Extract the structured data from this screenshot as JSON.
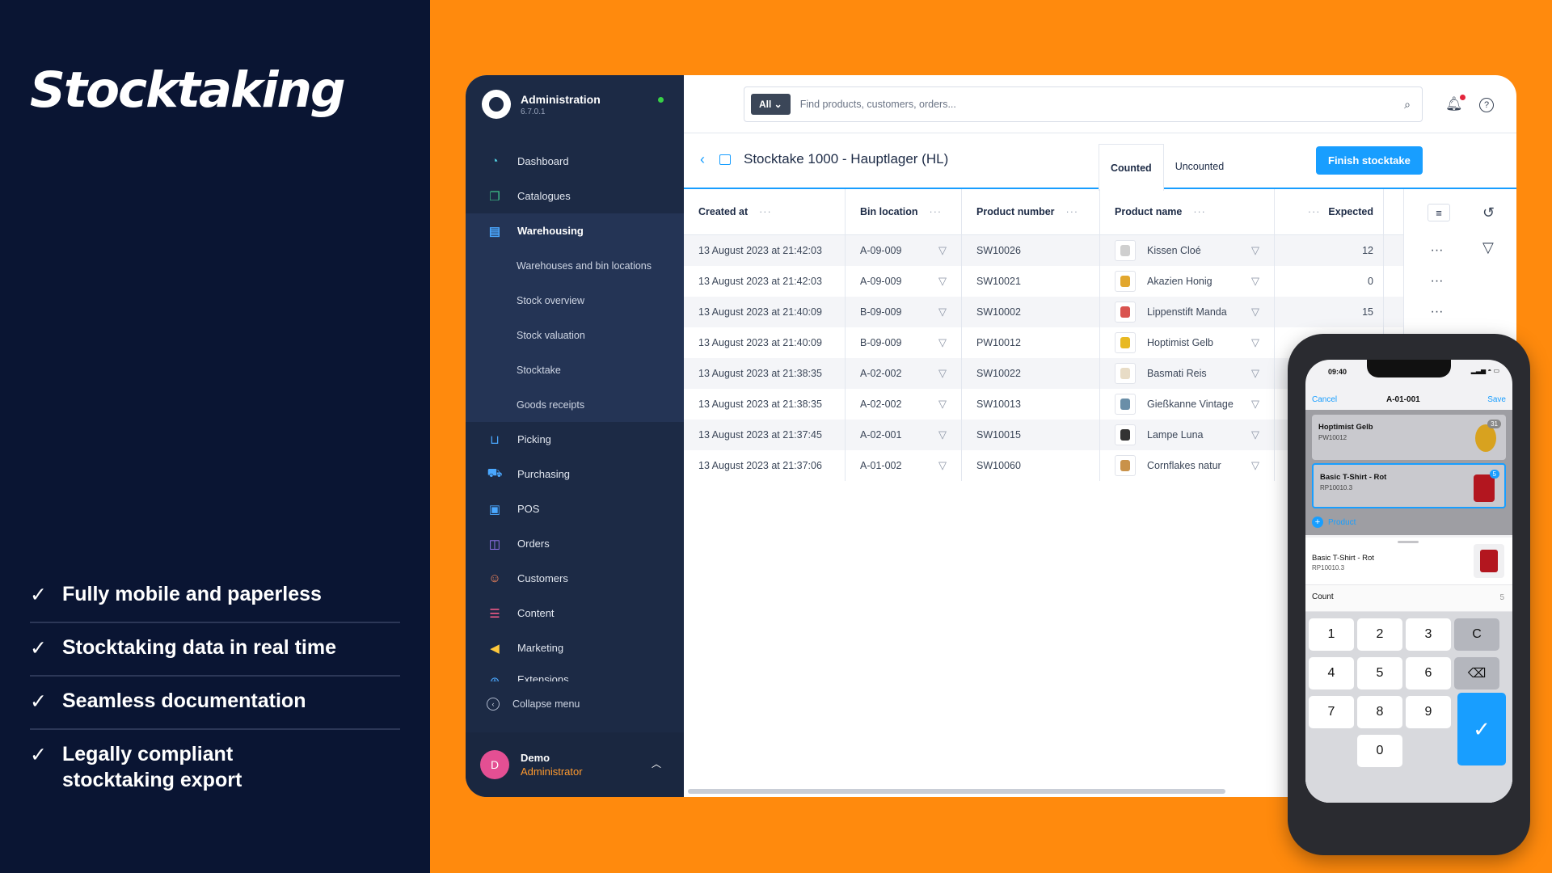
{
  "marketing": {
    "headline": "Stocktaking",
    "features": [
      {
        "label": "Fully mobile and paperless"
      },
      {
        "label": "Stocktaking data in real time"
      },
      {
        "label": "Seamless documentation"
      },
      {
        "label": "Legally compliant stocktaking export"
      }
    ]
  },
  "sidebar": {
    "app_title": "Administration",
    "version": "6.7.0.1",
    "items": [
      {
        "label": "Dashboard",
        "icon": "dashboard-icon"
      },
      {
        "label": "Catalogues",
        "icon": "catalogue-icon"
      },
      {
        "label": "Warehousing",
        "icon": "warehouse-icon"
      },
      {
        "label": "Picking",
        "icon": "picking-icon"
      },
      {
        "label": "Purchasing",
        "icon": "truck-icon"
      },
      {
        "label": "POS",
        "icon": "pos-icon"
      },
      {
        "label": "Orders",
        "icon": "bag-icon"
      },
      {
        "label": "Customers",
        "icon": "users-icon"
      },
      {
        "label": "Content",
        "icon": "content-icon"
      },
      {
        "label": "Marketing",
        "icon": "megaphone-icon"
      },
      {
        "label": "Extensions",
        "icon": "plug-icon"
      }
    ],
    "sub_items": [
      {
        "label": "Warehouses and bin locations"
      },
      {
        "label": "Stock overview"
      },
      {
        "label": "Stock valuation"
      },
      {
        "label": "Stocktake"
      },
      {
        "label": "Goods receipts"
      }
    ],
    "collapse_label": "Collapse menu",
    "user": {
      "initial": "D",
      "name": "Demo",
      "role": "Administrator"
    }
  },
  "topbar": {
    "search_scope": "All",
    "search_placeholder": "Find products, customers, orders..."
  },
  "page": {
    "title": "Stocktake 1000 - Hauptlager (HL)",
    "tabs": [
      {
        "label": "Counted"
      },
      {
        "label": "Uncounted"
      }
    ],
    "finish_label": "Finish stocktake"
  },
  "table": {
    "columns": [
      "Created at",
      "Bin location",
      "Product number",
      "Product name",
      "Expected"
    ],
    "rows": [
      {
        "created": "13 August 2023 at 21:42:03",
        "bin": "A-09-009",
        "number": "SW10026",
        "name": "Kissen Cloé",
        "expected": "12",
        "thumb": "#cfcfcf"
      },
      {
        "created": "13 August 2023 at 21:42:03",
        "bin": "A-09-009",
        "number": "SW10021",
        "name": "Akazien Honig",
        "expected": "0",
        "thumb": "#e2a72e"
      },
      {
        "created": "13 August 2023 at 21:40:09",
        "bin": "B-09-009",
        "number": "SW10002",
        "name": "Lippenstift Manda",
        "expected": "15",
        "thumb": "#d9534f"
      },
      {
        "created": "13 August 2023 at 21:40:09",
        "bin": "B-09-009",
        "number": "PW10012",
        "name": "Hoptimist Gelb",
        "expected": "",
        "thumb": "#e8b923"
      },
      {
        "created": "13 August 2023 at 21:38:35",
        "bin": "A-02-002",
        "number": "SW10022",
        "name": "Basmati Reis",
        "expected": "",
        "thumb": "#e8dcc6"
      },
      {
        "created": "13 August 2023 at 21:38:35",
        "bin": "A-02-002",
        "number": "SW10013",
        "name": "Gießkanne Vintage",
        "expected": "",
        "thumb": "#6a8ea8"
      },
      {
        "created": "13 August 2023 at 21:37:45",
        "bin": "A-02-001",
        "number": "SW10015",
        "name": "Lampe Luna",
        "expected": "",
        "thumb": "#333333"
      },
      {
        "created": "13 August 2023 at 21:37:06",
        "bin": "A-01-002",
        "number": "SW10060",
        "name": "Cornflakes natur",
        "expected": "",
        "thumb": "#c9924a"
      }
    ]
  },
  "phone": {
    "time": "09:40",
    "cancel": "Cancel",
    "title": "A-01-001",
    "save": "Save",
    "cards": [
      {
        "name": "Hoptimist Gelb",
        "number": "PW10012",
        "badge": "31",
        "color": "#d8a21f"
      },
      {
        "name": "Basic T-Shirt - Rot",
        "number": "RP10010.3",
        "badge": "5",
        "color": "#b3161f"
      }
    ],
    "add_label": "Product",
    "detail": {
      "name": "Basic T-Shirt - Rot",
      "number": "RP10010.3"
    },
    "count_label": "Count",
    "count_value": "5",
    "keys": [
      "1",
      "2",
      "3",
      "C",
      "4",
      "5",
      "6",
      "⌫",
      "7",
      "8",
      "9",
      "0"
    ]
  },
  "colors": {
    "accent": "#189eff",
    "sidebar": "#1c2a45",
    "background": "#ff8a0d",
    "panel": "#0a1533"
  }
}
